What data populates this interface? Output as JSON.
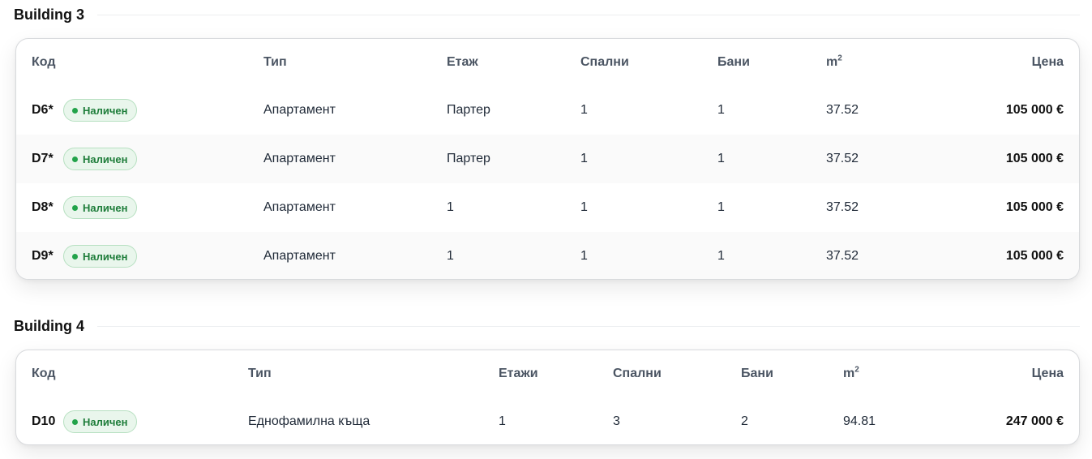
{
  "buildings": [
    {
      "title": "Building 3",
      "headers": {
        "code": "Код",
        "type": "Тип",
        "floor": "Етаж",
        "bedrooms": "Спални",
        "bathrooms": "Бани",
        "area": "m",
        "area_sup": "2",
        "price": "Цена"
      },
      "rows": [
        {
          "code": "D6*",
          "status": "Наличен",
          "type": "Апартамент",
          "floor": "Партер",
          "bedrooms": "1",
          "bathrooms": "1",
          "area": "37.52",
          "price": "105 000 €"
        },
        {
          "code": "D7*",
          "status": "Наличен",
          "type": "Апартамент",
          "floor": "Партер",
          "bedrooms": "1",
          "bathrooms": "1",
          "area": "37.52",
          "price": "105 000 €"
        },
        {
          "code": "D8*",
          "status": "Наличен",
          "type": "Апартамент",
          "floor": "1",
          "bedrooms": "1",
          "bathrooms": "1",
          "area": "37.52",
          "price": "105 000 €"
        },
        {
          "code": "D9*",
          "status": "Наличен",
          "type": "Апартамент",
          "floor": "1",
          "bedrooms": "1",
          "bathrooms": "1",
          "area": "37.52",
          "price": "105 000 €"
        }
      ]
    },
    {
      "title": "Building 4",
      "headers": {
        "code": "Код",
        "type": "Тип",
        "floor": "Етажи",
        "bedrooms": "Спални",
        "bathrooms": "Бани",
        "area": "m",
        "area_sup": "2",
        "price": "Цена"
      },
      "rows": [
        {
          "code": "D10",
          "status": "Наличен",
          "type": "Еднофамилна къща",
          "floor": "1",
          "bedrooms": "3",
          "bathrooms": "2",
          "area": "94.81",
          "price": "247 000 €"
        }
      ]
    }
  ],
  "colors": {
    "badge_bg": "#e9f6ec",
    "badge_text": "#1e7d3a",
    "badge_dot": "#22a34a"
  }
}
